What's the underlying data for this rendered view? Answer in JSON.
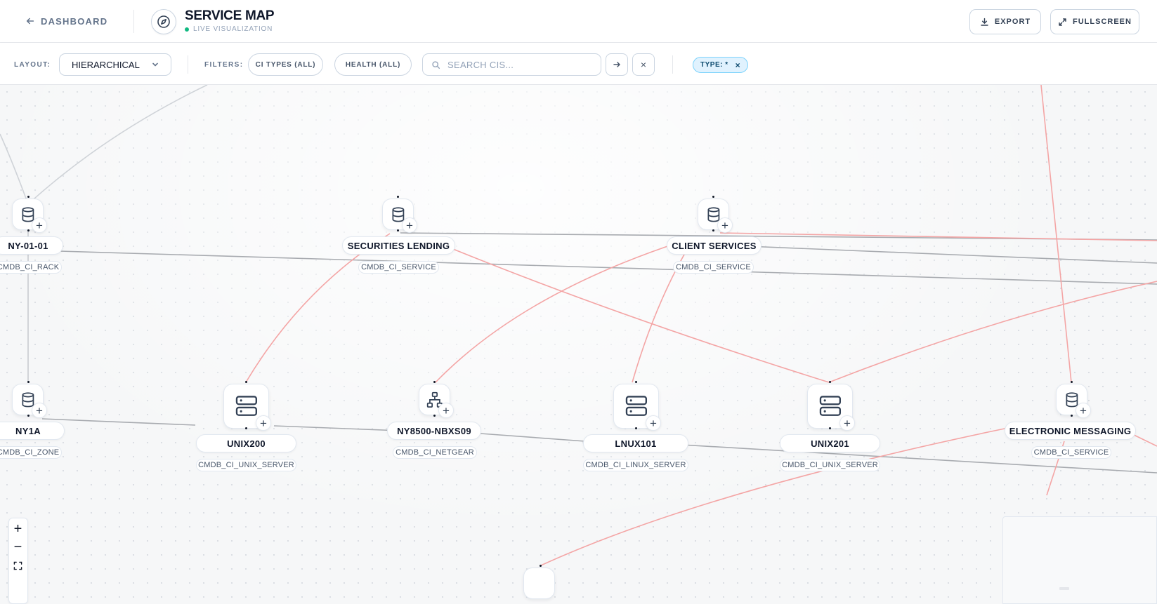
{
  "header": {
    "back_label": "DASHBOARD",
    "title": "SERVICE MAP",
    "subtitle": "LIVE VISUALIZATION",
    "export_label": "EXPORT",
    "fullscreen_label": "FULLSCREEN"
  },
  "toolbar": {
    "layout_label": "LAYOUT:",
    "layout_value": "HIERARCHICAL",
    "filters_label": "FILTERS:",
    "ci_types_filter": "CI TYPES (ALL)",
    "health_filter": "HEALTH (ALL)",
    "search_placeholder": "SEARCH CIS...",
    "type_chip": "TYPE: *",
    "type_chip_remove": "×",
    "clear_label": "×"
  },
  "nodes": {
    "ny0101": {
      "name": "NY-01-01",
      "type": "CMDB_CI_RACK",
      "icon": "database-icon"
    },
    "securities": {
      "name": "SECURITIES LENDING",
      "type": "CMDB_CI_SERVICE",
      "icon": "database-icon"
    },
    "client": {
      "name": "CLIENT SERVICES",
      "type": "CMDB_CI_SERVICE",
      "icon": "database-icon"
    },
    "ny1a": {
      "name": "NY1A",
      "type": "CMDB_CI_ZONE",
      "icon": "database-icon"
    },
    "unix200": {
      "name": "UNIX200",
      "type": "CMDB_CI_UNIX_SERVER",
      "icon": "server-icon"
    },
    "ny8500": {
      "name": "NY8500-NBXS09",
      "type": "CMDB_CI_NETGEAR",
      "icon": "network-icon"
    },
    "lnux101": {
      "name": "LNUX101",
      "type": "CMDB_CI_LINUX_SERVER",
      "icon": "server-icon"
    },
    "unix201": {
      "name": "UNIX201",
      "type": "CMDB_CI_UNIX_SERVER",
      "icon": "server-icon"
    },
    "electronic": {
      "name": "ELECTRONIC MESSAGING",
      "type": "CMDB_CI_SERVICE",
      "icon": "database-icon"
    }
  },
  "zoom": {
    "in": "+",
    "out": "−"
  },
  "colors": {
    "alert_edge": "#f4a5a5",
    "normal_edge": "#a8abb0",
    "accent_chip": "#e0f2fe",
    "live": "#10b981"
  }
}
